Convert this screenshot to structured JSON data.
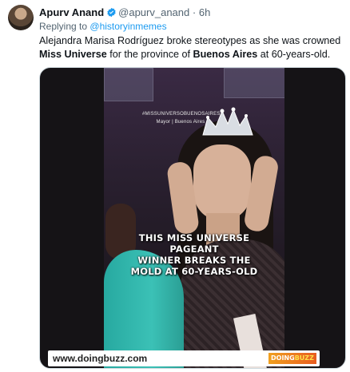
{
  "tweet": {
    "display_name": "Apurv Anand",
    "handle": "@apurv_anand",
    "separator": "·",
    "time": "6h",
    "replying_prefix": "Replying to",
    "replying_to": "@historyinmemes",
    "text_part1": "Alejandra Marisa Rodríguez broke stereotypes as she was crowned ",
    "text_bold1": "Miss Universe",
    "text_part2": " for the province of ",
    "text_bold2": "Buenos Aires",
    "text_part3": " at 60-years-old."
  },
  "media": {
    "overlay_line1": "#MISSUNIVERSOBUENOSAIRES",
    "overlay_line2": "Mayor | Buenos Aires",
    "caption_line1": "THIS MISS UNIVERSE PAGEANT",
    "caption_line2": "WINNER BREAKS THE",
    "caption_line3": "MOLD AT 60-YEARS-OLD",
    "footer_url": "www.doingbuzz.com",
    "logo_part1": "DOING",
    "logo_part2": "BUZZ"
  },
  "colors": {
    "verified_badge": "#1d9bf0",
    "link": "#1d9bf0",
    "secondary_text": "#536471",
    "primary_text": "#0f1419"
  },
  "icons": [
    "verified-badge-icon"
  ]
}
